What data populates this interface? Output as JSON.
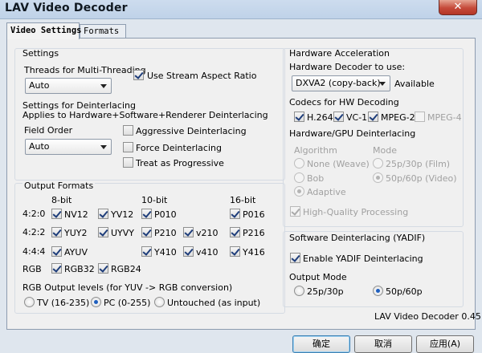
{
  "window": {
    "title": "LAV Video Decoder",
    "close_label": "✕"
  },
  "tabs": [
    {
      "label": "Video Settings",
      "active": true
    },
    {
      "label": "Formats",
      "active": false
    }
  ],
  "settings": {
    "group_label": "Settings",
    "threads_label": "Threads for Multi-Threading",
    "threads_value": "Auto",
    "stream_aspect_label": "Use Stream Aspect Ratio",
    "stream_aspect_checked": true,
    "deint_label": "Settings for Deinterlacing",
    "deint_sub_label": "Applies to Hardware+Software+Renderer Deinterlacing",
    "field_order_label": "Field Order",
    "field_order_value": "Auto",
    "aggressive_label": "Aggressive Deinterlacing",
    "force_label": "Force Deinterlacing",
    "progressive_label": "Treat as Progressive"
  },
  "output": {
    "group_label": "Output Formats",
    "col_8bit": "8-bit",
    "col_10bit": "10-bit",
    "col_16bit": "16-bit",
    "row_420": "4:2:0",
    "row_422": "4:2:2",
    "row_444": "4:4:4",
    "row_rgb": "RGB",
    "fmt": {
      "nv12": "NV12",
      "yv12": "YV12",
      "p010": "P010",
      "p016": "P016",
      "yuy2": "YUY2",
      "uyvy": "UYVY",
      "p210": "P210",
      "v210": "v210",
      "p216": "P216",
      "ayuv": "AYUV",
      "y410": "Y410",
      "v410": "v410",
      "y416": "Y416",
      "rgb32": "RGB32",
      "rgb24": "RGB24"
    },
    "levels_label": "RGB Output levels (for YUV -> RGB conversion)",
    "level_tv": "TV (16-235)",
    "level_pc": "PC (0-255)",
    "level_untouched": "Untouched (as input)"
  },
  "hw": {
    "group_label": "Hardware Acceleration",
    "decoder_label": "Hardware Decoder to use:",
    "decoder_value": "DXVA2 (copy-back)",
    "available_label": "Available",
    "codecs_label": "Codecs for HW Decoding",
    "codec_h264": "H.264",
    "codec_vc1": "VC-1",
    "codec_mpeg2": "MPEG-2",
    "codec_mpeg4": "MPEG-4",
    "gpu_deint_label": "Hardware/GPU Deinterlacing",
    "algorithm_label": "Algorithm",
    "mode_label": "Mode",
    "alg_none": "None (Weave)",
    "alg_bob": "Bob",
    "alg_adaptive": "Adaptive",
    "mode_film": "25p/30p (Film)",
    "mode_video": "50p/60p (Video)",
    "hq_label": "High-Quality Processing"
  },
  "yadif": {
    "group_label": "Software Deinterlacing (YADIF)",
    "enable_label": "Enable YADIF Deinterlacing",
    "output_mode_label": "Output Mode",
    "mode_25": "25p/30p",
    "mode_50": "50p/60p"
  },
  "version": "LAV Video Decoder 0.45",
  "buttons": {
    "ok": "确定",
    "cancel": "取消",
    "apply": "应用(A)"
  }
}
